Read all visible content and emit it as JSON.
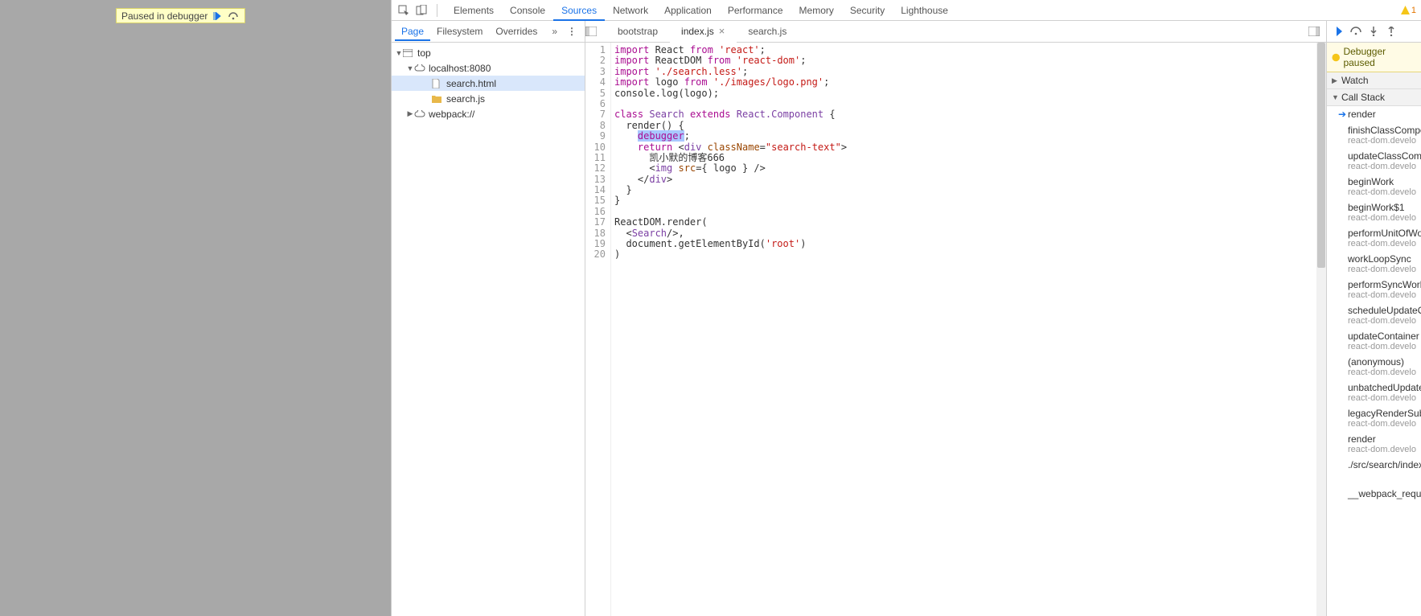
{
  "paused_badge": {
    "text": "Paused in debugger"
  },
  "top_tabs": [
    "Elements",
    "Console",
    "Sources",
    "Network",
    "Application",
    "Performance",
    "Memory",
    "Security",
    "Lighthouse"
  ],
  "top_active": "Sources",
  "warn_count": "1",
  "nav_tabs": [
    "Page",
    "Filesystem",
    "Overrides"
  ],
  "nav_active": "Page",
  "tree": [
    {
      "depth": 0,
      "tri": "▼",
      "icon": "window",
      "label": "top"
    },
    {
      "depth": 1,
      "tri": "▼",
      "icon": "cloud",
      "label": "localhost:8080"
    },
    {
      "depth": 2,
      "tri": "",
      "icon": "file",
      "label": "search.html",
      "selected": true
    },
    {
      "depth": 2,
      "tri": "",
      "icon": "folder",
      "label": "search.js"
    },
    {
      "depth": 1,
      "tri": "▶",
      "icon": "cloud",
      "label": "webpack://"
    }
  ],
  "editor_tabs": [
    {
      "name": "bootstrap",
      "active": false,
      "closable": false
    },
    {
      "name": "index.js",
      "active": true,
      "closable": true
    },
    {
      "name": "search.js",
      "active": false,
      "closable": false
    }
  ],
  "code_lines": [
    [
      [
        "kw",
        "import"
      ],
      [
        "",
        " React "
      ],
      [
        "kw",
        "from"
      ],
      [
        "",
        " "
      ],
      [
        "str",
        "'react'"
      ],
      [
        "",
        ";"
      ]
    ],
    [
      [
        "kw",
        "import"
      ],
      [
        "",
        " ReactDOM "
      ],
      [
        "kw",
        "from"
      ],
      [
        "",
        " "
      ],
      [
        "str",
        "'react-dom'"
      ],
      [
        "",
        ";"
      ]
    ],
    [
      [
        "kw",
        "import"
      ],
      [
        "",
        " "
      ],
      [
        "str",
        "'./search.less'"
      ],
      [
        "",
        ";"
      ]
    ],
    [
      [
        "kw",
        "import"
      ],
      [
        "",
        " logo "
      ],
      [
        "kw",
        "from"
      ],
      [
        "",
        " "
      ],
      [
        "str",
        "'./images/logo.png'"
      ],
      [
        "",
        ";"
      ]
    ],
    [
      [
        "",
        "console.log(logo);"
      ]
    ],
    [
      [
        "",
        ""
      ]
    ],
    [
      [
        "kw",
        "class"
      ],
      [
        "",
        " "
      ],
      [
        "cls",
        "Search"
      ],
      [
        "",
        " "
      ],
      [
        "kw",
        "extends"
      ],
      [
        "",
        " "
      ],
      [
        "cls",
        "React.Component"
      ],
      [
        "",
        " {"
      ]
    ],
    [
      [
        "",
        "  render() {"
      ]
    ],
    [
      [
        "",
        "    "
      ],
      [
        "dbg",
        "debugger"
      ],
      [
        "",
        ";"
      ]
    ],
    [
      [
        "",
        "    "
      ],
      [
        "kw",
        "return"
      ],
      [
        "",
        " <"
      ],
      [
        "tag",
        "div"
      ],
      [
        "",
        " "
      ],
      [
        "attr",
        "className"
      ],
      [
        "",
        "="
      ],
      [
        "str",
        "\"search-text\""
      ],
      [
        "",
        ">"
      ]
    ],
    [
      [
        "",
        "      凯小默的博客666"
      ]
    ],
    [
      [
        "",
        "      <"
      ],
      [
        "tag",
        "img"
      ],
      [
        "",
        " "
      ],
      [
        "attr",
        "src"
      ],
      [
        "",
        "={ logo } />"
      ]
    ],
    [
      [
        "",
        "    </"
      ],
      [
        "tag",
        "div"
      ],
      [
        "",
        ">"
      ]
    ],
    [
      [
        "",
        "  }"
      ]
    ],
    [
      [
        "",
        "}"
      ]
    ],
    [
      [
        "",
        ""
      ]
    ],
    [
      [
        "",
        "ReactDOM.render("
      ]
    ],
    [
      [
        "",
        "  <"
      ],
      [
        "tag",
        "Search"
      ],
      [
        "",
        "/>,"
      ]
    ],
    [
      [
        "",
        "  document.getElementById("
      ],
      [
        "str",
        "'root'"
      ],
      [
        "",
        ")"
      ]
    ],
    [
      [
        "",
        ")"
      ]
    ]
  ],
  "highlight_line_index": 8,
  "dbg_banner": "Debugger paused",
  "panels": {
    "watch": "Watch",
    "callstack": "Call Stack"
  },
  "callstack": [
    {
      "name": "render",
      "loc": "",
      "current": true
    },
    {
      "name": "finishClassCompon",
      "loc": "react-dom.develo"
    },
    {
      "name": "updateClassCompo",
      "loc": "react-dom.develo"
    },
    {
      "name": "beginWork",
      "loc": "react-dom.develo"
    },
    {
      "name": "beginWork$1",
      "loc": "react-dom.develo"
    },
    {
      "name": "performUnitOfWor",
      "loc": "react-dom.develo"
    },
    {
      "name": "workLoopSync",
      "loc": "react-dom.develo"
    },
    {
      "name": "performSyncWorkC",
      "loc": "react-dom.develo"
    },
    {
      "name": "scheduleUpdateOn",
      "loc": "react-dom.develo"
    },
    {
      "name": "updateContainer",
      "loc": "react-dom.develo"
    },
    {
      "name": "(anonymous)",
      "loc": "react-dom.develo"
    },
    {
      "name": "unbatchedUpdates",
      "loc": "react-dom.develo"
    },
    {
      "name": "legacyRenderSubtr",
      "loc": "react-dom.develo"
    },
    {
      "name": "render",
      "loc": "react-dom.develo"
    },
    {
      "name": "./src/search/index.j",
      "loc": ""
    },
    {
      "name": "",
      "loc": ""
    },
    {
      "name": "__webpack_require",
      "loc": ""
    }
  ]
}
